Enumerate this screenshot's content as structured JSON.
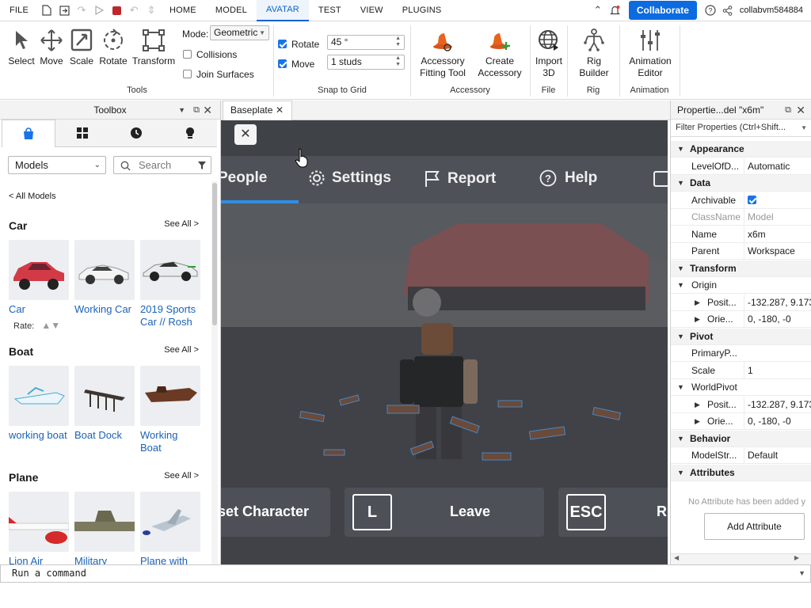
{
  "menubar": {
    "file": "FILE",
    "tabs": [
      "HOME",
      "MODEL",
      "AVATAR",
      "TEST",
      "VIEW",
      "PLUGINS"
    ],
    "active_tab": "AVATAR",
    "collaborate": "Collaborate",
    "username": "collabvm584884"
  },
  "ribbon": {
    "tools": {
      "select": "Select",
      "move": "Move",
      "scale": "Scale",
      "rotate": "Rotate",
      "transform": "Transform",
      "mode_label": "Mode:",
      "mode_value": "Geometric",
      "collisions": "Collisions",
      "join_surfaces": "Join Surfaces",
      "group": "Tools"
    },
    "snap": {
      "rotate_label": "Rotate",
      "rotate_value": "45 °",
      "move_label": "Move",
      "move_value": "1 studs",
      "group": "Snap to Grid"
    },
    "accessory": {
      "fitting_tool_1": "Accessory",
      "fitting_tool_2": "Fitting Tool",
      "create_1": "Create",
      "create_2": "Accessory",
      "group": "Accessory"
    },
    "file": {
      "import_1": "Import",
      "import_2": "3D",
      "group": "File"
    },
    "rig": {
      "builder_1": "Rig",
      "builder_2": "Builder",
      "group": "Rig"
    },
    "animation": {
      "editor_1": "Animation",
      "editor_2": "Editor",
      "group": "Animation"
    }
  },
  "toolbox": {
    "title": "Toolbox",
    "category_select": "Models",
    "search_placeholder": "Search",
    "back_link": "< All Models",
    "see_all": "See All >",
    "rate_label": "Rate:",
    "sections": [
      {
        "title": "Car",
        "items": [
          "Car",
          "Working Car",
          "2019 Sports Car // Rosh"
        ]
      },
      {
        "title": "Boat",
        "items": [
          "working boat",
          "Boat Dock",
          "Working Boat"
        ]
      },
      {
        "title": "Plane",
        "items": [
          "Lion Air",
          "Military",
          "Plane with"
        ]
      }
    ]
  },
  "document_tab": {
    "label": "Baseplate"
  },
  "viewport": {
    "menu": [
      "People",
      "Settings",
      "Report",
      "Help"
    ],
    "buttons": {
      "reset": "set Character",
      "leave_key": "L",
      "leave": "Leave",
      "esc_key": "ESC",
      "resume": "R"
    }
  },
  "properties": {
    "title": "Propertie...del \"x6m\"",
    "filter_placeholder": "Filter Properties (Ctrl+Shift...",
    "rows": [
      {
        "type": "sec",
        "label": "Appearance"
      },
      {
        "type": "prop",
        "key": "LevelOfD...",
        "value": "Automatic"
      },
      {
        "type": "sec",
        "label": "Data"
      },
      {
        "type": "check",
        "key": "Archivable"
      },
      {
        "type": "prop",
        "key": "ClassName",
        "value": "Model",
        "dim": true
      },
      {
        "type": "prop",
        "key": "Name",
        "value": "x6m"
      },
      {
        "type": "prop",
        "key": "Parent",
        "value": "Workspace"
      },
      {
        "type": "sec",
        "label": "Transform"
      },
      {
        "type": "sub",
        "key": "Origin",
        "value": ""
      },
      {
        "type": "sub2",
        "key": "Posit...",
        "value": "-132.287, 9.173, ..."
      },
      {
        "type": "sub2",
        "key": "Orie...",
        "value": "0, -180, -0"
      },
      {
        "type": "sec",
        "label": "Pivot"
      },
      {
        "type": "prop",
        "key": "PrimaryP...",
        "value": ""
      },
      {
        "type": "prop",
        "key": "Scale",
        "value": "1"
      },
      {
        "type": "sub",
        "key": "WorldPivot",
        "value": ""
      },
      {
        "type": "sub2",
        "key": "Posit...",
        "value": "-132.287, 9.173, ..."
      },
      {
        "type": "sub2",
        "key": "Orie...",
        "value": "0, -180, -0"
      },
      {
        "type": "sec",
        "label": "Behavior"
      },
      {
        "type": "prop",
        "key": "ModelStr...",
        "value": "Default"
      },
      {
        "type": "sec",
        "label": "Attributes"
      }
    ],
    "no_attribute": "No Attribute has been added y",
    "add_attribute": "Add Attribute"
  },
  "command_bar": {
    "placeholder": "Run a command"
  },
  "colors": {
    "accent": "#0c6be0",
    "stop": "#c0272d",
    "link": "#1a62b8"
  }
}
